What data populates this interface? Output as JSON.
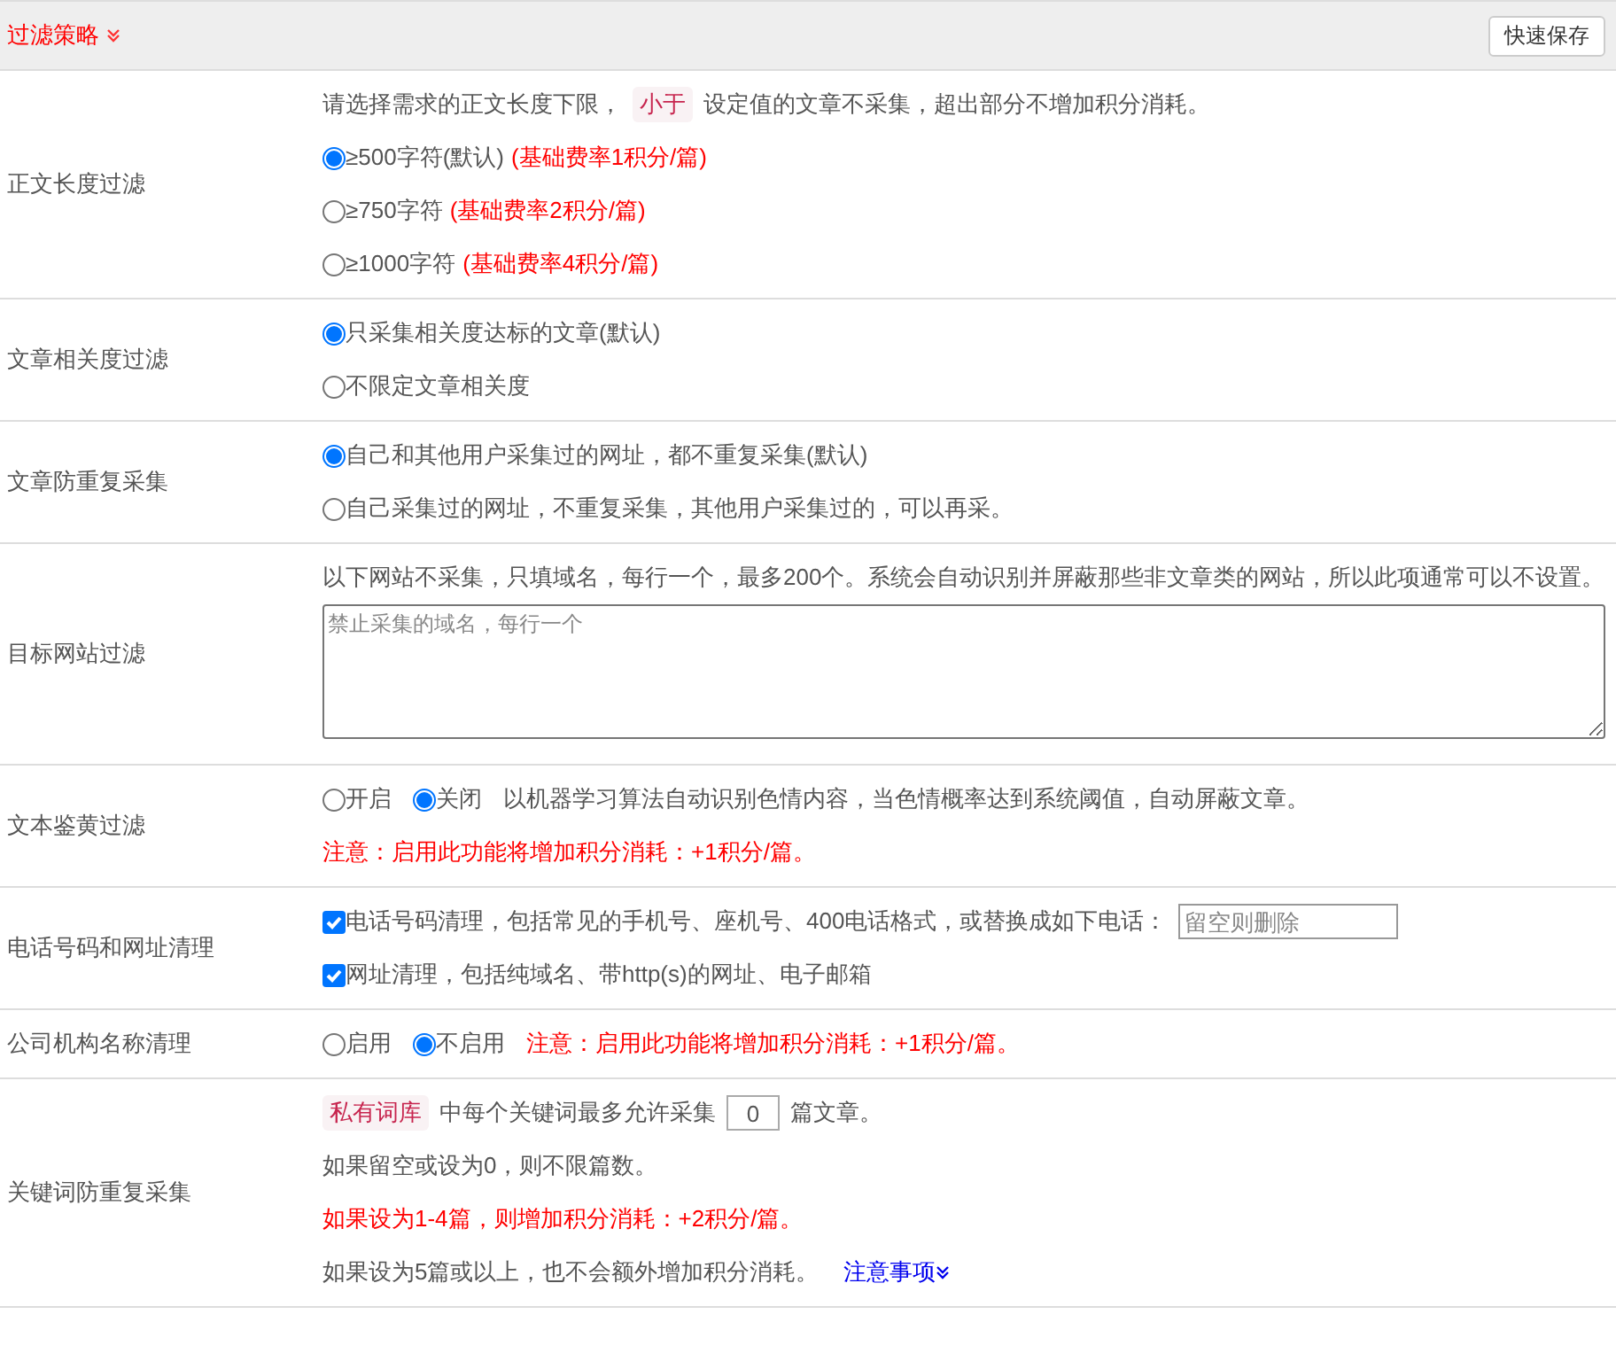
{
  "header": {
    "title": "过滤策略",
    "save_button": "快速保存"
  },
  "rows": [
    {
      "label": "正文长度过滤",
      "lines": [
        [
          {
            "kind": "text",
            "text": "请选择需求的正文长度下限，"
          },
          {
            "kind": "tag",
            "text": "小于"
          },
          {
            "kind": "text",
            "text": "设定值的文章不采集，超出部分不增加积分消耗。"
          }
        ],
        [
          {
            "kind": "radio",
            "label": "≥500字符(默认)",
            "note": "(基础费率1积分/篇)",
            "selected": true
          }
        ],
        [
          {
            "kind": "radio",
            "label": "≥750字符",
            "note": "(基础费率2积分/篇)",
            "selected": false
          }
        ],
        [
          {
            "kind": "radio",
            "label": "≥1000字符",
            "note": "(基础费率4积分/篇)",
            "selected": false
          }
        ]
      ]
    },
    {
      "label": "文章相关度过滤",
      "lines": [
        [
          {
            "kind": "radio",
            "label": "只采集相关度达标的文章(默认)",
            "selected": true
          }
        ],
        [
          {
            "kind": "radio",
            "label": "不限定文章相关度",
            "selected": false
          }
        ]
      ]
    },
    {
      "label": "文章防重复采集",
      "lines": [
        [
          {
            "kind": "radio",
            "label": "自己和其他用户采集过的网址，都不重复采集(默认)",
            "selected": true
          }
        ],
        [
          {
            "kind": "radio",
            "label": "自己采集过的网址，不重复采集，其他用户采集过的，可以再采。",
            "selected": false
          }
        ]
      ]
    },
    {
      "label": "目标网站过滤",
      "lines": [
        [
          {
            "kind": "text",
            "text": "以下网站不采集，只填域名，每行一个，最多200个。系统会自动识别并屏蔽那些非文章类的网站，所以此项通常可以不设置。"
          }
        ],
        [
          {
            "kind": "textarea",
            "placeholder": "禁止采集的域名，每行一个"
          }
        ]
      ]
    },
    {
      "label": "文本鉴黄过滤",
      "lines": [
        [
          {
            "kind": "radio",
            "label": "开启",
            "selected": false
          },
          {
            "kind": "radio",
            "label": "关闭",
            "selected": true
          },
          {
            "kind": "text",
            "text": "以机器学习算法自动识别色情内容，当色情概率达到系统阈值，自动屏蔽文章。"
          }
        ],
        [
          {
            "kind": "warning",
            "text": "注意：启用此功能将增加积分消耗：+1积分/篇。"
          }
        ]
      ]
    },
    {
      "label": "电话号码和网址清理",
      "lines": [
        [
          {
            "kind": "checkbox",
            "label": "电话号码清理，包括常见的手机号、座机号、400电话格式，或替换成如下电话：",
            "checked": true
          },
          {
            "kind": "field",
            "placeholder": "留空则删除"
          }
        ],
        [
          {
            "kind": "checkbox",
            "label": "网址清理，包括纯域名、带http(s)的网址、电子邮箱",
            "checked": true
          }
        ]
      ]
    },
    {
      "label": "公司机构名称清理",
      "lines": [
        [
          {
            "kind": "radio",
            "label": "启用",
            "selected": false
          },
          {
            "kind": "radio",
            "label": "不启用",
            "selected": true
          },
          {
            "kind": "warning",
            "text": "注意：启用此功能将增加积分消耗：+1积分/篇。"
          }
        ]
      ]
    },
    {
      "label": "关键词防重复采集",
      "lines": [
        [
          {
            "kind": "tag",
            "text": "私有词库"
          },
          {
            "kind": "text",
            "text": "中每个关键词最多允许采集"
          },
          {
            "kind": "number",
            "value": "0"
          },
          {
            "kind": "text",
            "text": "篇文章。"
          }
        ],
        [
          {
            "kind": "text",
            "text": "如果留空或设为0，则不限篇数。"
          }
        ],
        [
          {
            "kind": "warning",
            "text": "如果设为1-4篇，则增加积分消耗：+2积分/篇。"
          }
        ],
        [
          {
            "kind": "text",
            "text": "如果设为5篇或以上，也不会额外增加积分消耗。"
          },
          {
            "kind": "link",
            "text": "注意事项"
          }
        ]
      ]
    }
  ]
}
